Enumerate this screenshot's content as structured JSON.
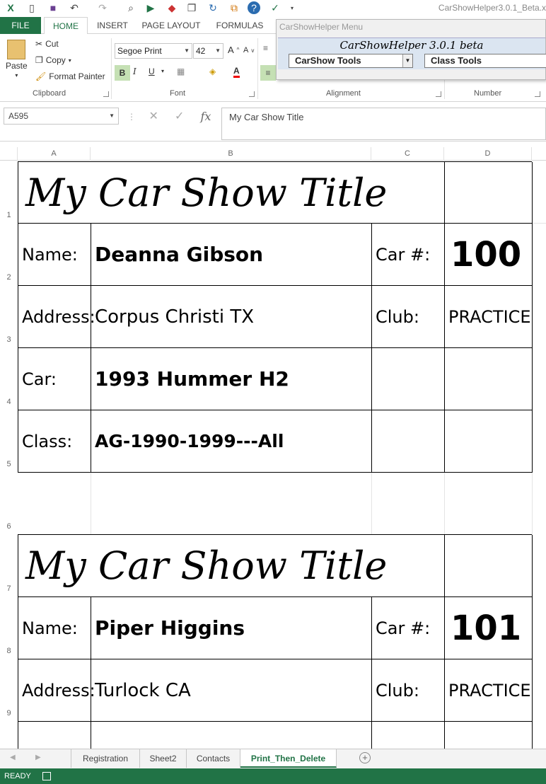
{
  "window": {
    "title": "CarShowHelper3.0.1_Beta.x"
  },
  "ribbon": {
    "tabs": [
      "FILE",
      "HOME",
      "INSERT",
      "PAGE LAYOUT",
      "FORMULAS"
    ],
    "clipboard": {
      "paste": "Paste",
      "cut": "Cut",
      "copy": "Copy",
      "format_painter": "Format Painter",
      "label": "Clipboard"
    },
    "font": {
      "family": "Segoe Print",
      "size": "42",
      "label": "Font",
      "bold": "B",
      "italic": "I",
      "underline": "U"
    },
    "alignment_label": "Alignment",
    "number_label": "Number"
  },
  "addin": {
    "menu_title": "CarShowHelper Menu",
    "banner": "CarShowHelper 3.0.1 beta",
    "carshow_tools": "CarShow Tools",
    "class_tools": "Class Tools"
  },
  "formula_bar": {
    "name_box": "A595",
    "content": "My Car Show Title"
  },
  "columns": [
    "A",
    "B",
    "C",
    "D"
  ],
  "rows": [
    "1",
    "2",
    "3",
    "4",
    "5",
    "6",
    "7",
    "8",
    "9"
  ],
  "cards": [
    {
      "title": "My Car Show Title",
      "name_label": "Name:",
      "name": "Deanna Gibson",
      "car_num_label": "Car #:",
      "car_num": "100",
      "address_label": "Address:",
      "address": "Corpus Christi TX",
      "club_label": "Club:",
      "club": "PRACTICE",
      "car_label": "Car:",
      "car": "1993 Hummer H2",
      "class_label": "Class:",
      "class": "AG-1990-1999---All"
    },
    {
      "title": "My Car Show Title",
      "name_label": "Name:",
      "name": "Piper Higgins",
      "car_num_label": "Car #:",
      "car_num": "101",
      "address_label": "Address:",
      "address": "Turlock CA",
      "club_label": "Club:",
      "club": "PRACTICE"
    }
  ],
  "sheets": [
    "Registration",
    "Sheet2",
    "Contacts",
    "Print_Then_Delete"
  ],
  "status": {
    "text": "READY"
  }
}
